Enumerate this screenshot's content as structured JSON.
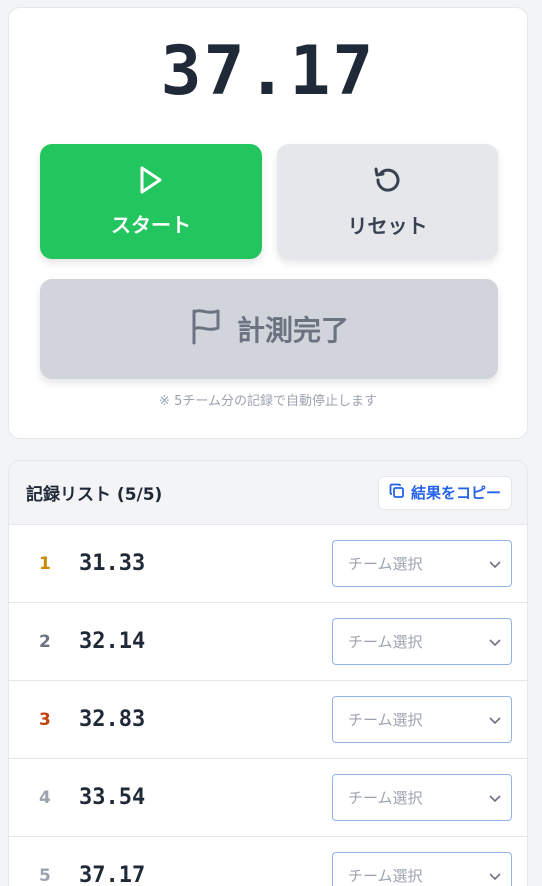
{
  "timer": {
    "display": "37.17"
  },
  "buttons": {
    "start_label": "スタート",
    "reset_label": "リセット",
    "finish_label": "計測完了"
  },
  "note": "※ 5チーム分の記録で自動停止します",
  "records": {
    "title": "記録リスト (5/5)",
    "copy_label": "結果をコピー",
    "items": [
      {
        "rank": "1",
        "time": "31.33",
        "team_placeholder": "チーム選択",
        "rank_color": "#ca8a04"
      },
      {
        "rank": "2",
        "time": "32.14",
        "team_placeholder": "チーム選択",
        "rank_color": "#6b7280"
      },
      {
        "rank": "3",
        "time": "32.83",
        "team_placeholder": "チーム選択",
        "rank_color": "#c2410c"
      },
      {
        "rank": "4",
        "time": "33.54",
        "team_placeholder": "チーム選択",
        "rank_color": "#9ca3af"
      },
      {
        "rank": "5",
        "time": "37.17",
        "team_placeholder": "チーム選択",
        "rank_color": "#9ca3af"
      }
    ]
  },
  "colors": {
    "start": "#22c55e",
    "reset": "#e5e7eb",
    "finish": "#d1d5db",
    "accent": "#2563eb"
  },
  "icons": {
    "start": "play-icon",
    "reset": "rotate-ccw-icon",
    "finish": "flag-icon",
    "copy": "copy-icon",
    "select": "chevron-down-icon"
  }
}
